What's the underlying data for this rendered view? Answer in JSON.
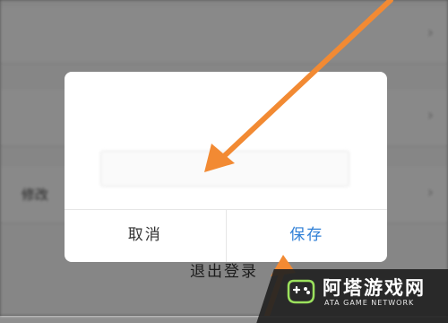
{
  "background": {
    "rows": [
      {
        "label": "",
        "value": ""
      },
      {
        "label": "",
        "value": ""
      },
      {
        "label": "修改",
        "value": ""
      }
    ],
    "logout_label": "退出登录"
  },
  "dialog": {
    "title": "",
    "input_value": "",
    "cancel_label": "取消",
    "save_label": "保存"
  },
  "watermark": {
    "title": "阿塔游戏网",
    "subtitle": "ATA GAME NETWORK"
  },
  "colors": {
    "accent": "#2f7fd6",
    "annotation": "#f28a33"
  }
}
